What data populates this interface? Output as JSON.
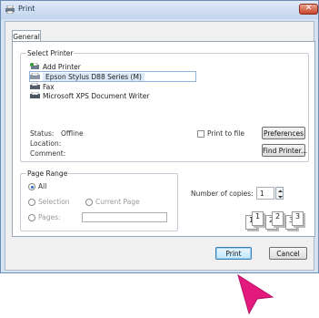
{
  "window": {
    "title": "Print",
    "close_glyph": "✕",
    "accent": "#c9422b"
  },
  "tabs": [
    {
      "label": "General",
      "selected": true
    }
  ],
  "select_printer": {
    "title": "Select Printer",
    "printers": [
      {
        "name": "Add Printer",
        "icon": "add-printer-icon",
        "selected": false
      },
      {
        "name": "Epson Stylus D88 Series (M)",
        "icon": "printer-icon",
        "selected": true
      },
      {
        "name": "Fax",
        "icon": "fax-icon",
        "selected": false
      },
      {
        "name": "Microsoft XPS Document Writer",
        "icon": "printer-icon",
        "selected": false
      }
    ],
    "status_label": "Status:",
    "status_value": "Offline",
    "location_label": "Location:",
    "comment_label": "Comment:",
    "print_to_file_label": "Print to file",
    "print_to_file_checked": false,
    "preferences_button": "Preferences",
    "find_printer_button": "Find Printer..."
  },
  "page_range": {
    "title": "Page Range",
    "options": [
      {
        "label": "All",
        "checked": true,
        "disabled": false
      },
      {
        "label": "Selection",
        "checked": false,
        "disabled": true
      },
      {
        "label": "Current Page",
        "checked": false,
        "disabled": true
      },
      {
        "label": "Pages:",
        "checked": false,
        "disabled": true
      }
    ],
    "pages_value": ""
  },
  "copies": {
    "label": "Number of copies:",
    "value": "1",
    "collate_pages": [
      "1",
      "1",
      "2",
      "2",
      "3",
      "3"
    ]
  },
  "footer": {
    "print_button": "Print",
    "cancel_button": "Cancel"
  }
}
